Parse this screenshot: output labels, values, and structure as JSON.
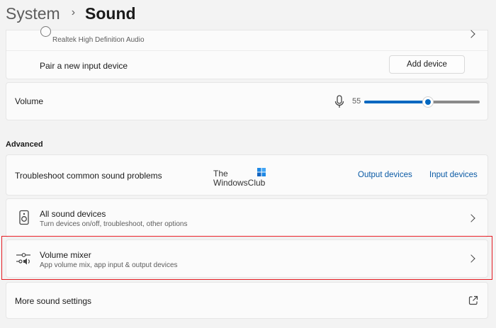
{
  "breadcrumb": {
    "parent": "System",
    "separator": "›",
    "current": "Sound"
  },
  "input_device": {
    "name_sub": "Realtek High Definition Audio"
  },
  "pair": {
    "label": "Pair a new input device",
    "button": "Add device"
  },
  "volume": {
    "label": "Volume",
    "value": "55",
    "level_percent": 55,
    "accent_color": "#0067c0"
  },
  "advanced": {
    "title": "Advanced",
    "troubleshoot": {
      "label": "Troubleshoot common sound problems",
      "link_output": "Output devices",
      "link_input": "Input devices"
    }
  },
  "watermark": {
    "line1": "The",
    "line2": "WindowsClub"
  },
  "items": [
    {
      "icon": "speaker-icon",
      "title": "All sound devices",
      "subtitle": "Turn devices on/off, troubleshoot, other options"
    },
    {
      "icon": "volume-mixer-icon",
      "title": "Volume mixer",
      "subtitle": "App volume mix, app input & output devices"
    }
  ],
  "more": {
    "label": "More sound settings",
    "icon": "external-link-icon"
  },
  "highlight_color": "#e51c23"
}
